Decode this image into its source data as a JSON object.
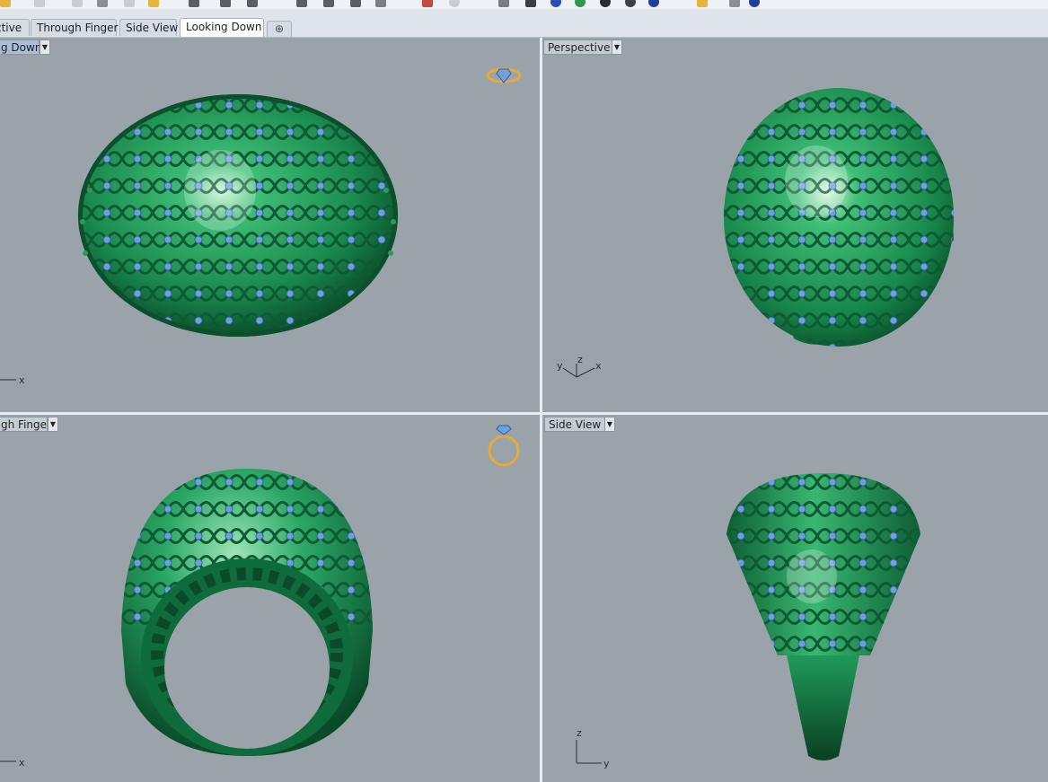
{
  "tabs": [
    {
      "label": "ctive",
      "active": false
    },
    {
      "label": "Through Finger",
      "active": false
    },
    {
      "label": "Side View",
      "active": false
    },
    {
      "label": "Looking Down",
      "active": true
    }
  ],
  "tab_add_symbol": "⊕",
  "viewports": {
    "top_left": {
      "label": "g Down",
      "active": true
    },
    "top_right": {
      "label": "Perspective",
      "active": false
    },
    "bottom_left": {
      "label": "gh Finger",
      "active": false
    },
    "bottom_right": {
      "label": "Side View",
      "active": false
    }
  },
  "dropdown_arrow": "▼",
  "axes": {
    "top_left": [
      "x"
    ],
    "top_right": [
      "y",
      "z",
      "x"
    ],
    "bottom_left": [
      "x"
    ],
    "bottom_right": [
      "z",
      "y"
    ]
  },
  "colors": {
    "ring_green": "#1f9a5a",
    "ring_dark": "#0d5a33",
    "gem_blue": "#6f9fdc",
    "gold_icon": "#e6a93a",
    "active_tab": "#ffffff",
    "viewport_bg": "#9aa2aa"
  },
  "icons": [
    "ring-top-icon",
    "ring-side-icon"
  ]
}
